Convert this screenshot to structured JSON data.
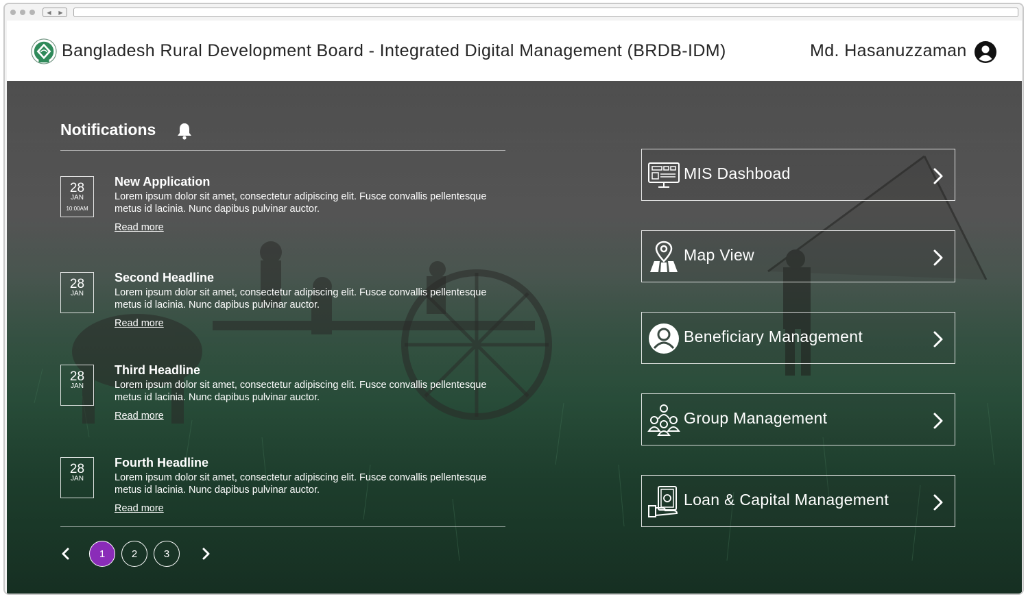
{
  "header": {
    "app_title": "Bangladesh Rural Development Board - Integrated Digital Management (BRDB-IDM)",
    "user_name": "Md. Hasanuzzaman",
    "logo_icon": "brdb-logo-icon",
    "user_icon": "user-circle-icon"
  },
  "notifications": {
    "title": "Notifications",
    "title_icon": "bell-icon",
    "items": [
      {
        "day": "28",
        "month": "JAN",
        "time": "10:00AM",
        "title": "New Application",
        "body": "Lorem ipsum dolor sit amet, consectetur adipiscing elit. Fusce convallis pellentesque metus id lacinia. Nunc dapibus pulvinar auctor.",
        "link": "Read more"
      },
      {
        "day": "28",
        "month": "JAN",
        "title": "Second Headline",
        "body": "Lorem ipsum dolor sit amet, consectetur adipiscing elit. Fusce convallis pellentesque metus id lacinia. Nunc dapibus pulvinar auctor.",
        "link": "Read more"
      },
      {
        "day": "28",
        "month": "JAN",
        "title": "Third Headline",
        "body": "Lorem ipsum dolor sit amet, consectetur adipiscing elit. Fusce convallis pellentesque metus id lacinia. Nunc dapibus pulvinar auctor.",
        "link": "Read more"
      },
      {
        "day": "28",
        "month": "JAN",
        "title": "Fourth Headline",
        "body": "Lorem ipsum dolor sit amet, consectetur adipiscing elit. Fusce convallis pellentesque metus id lacinia. Nunc dapibus pulvinar auctor.",
        "link": "Read more"
      }
    ]
  },
  "pagination": {
    "pages": [
      "1",
      "2",
      "3"
    ],
    "active_page": "1",
    "active_color": "#8a2cb8",
    "prev_icon": "chevron-left-icon",
    "next_icon": "chevron-right-icon"
  },
  "menu": {
    "items": [
      {
        "label": "MIS Dashboad",
        "icon": "monitor-dashboard-icon"
      },
      {
        "label": "Map View",
        "icon": "map-pin-icon"
      },
      {
        "label": "Beneficiary Management",
        "icon": "person-circle-icon"
      },
      {
        "label": "Group Management",
        "icon": "group-people-icon"
      },
      {
        "label": "Loan & Capital Management",
        "icon": "money-hand-icon"
      }
    ],
    "chevron_icon": "chevron-right-icon"
  }
}
